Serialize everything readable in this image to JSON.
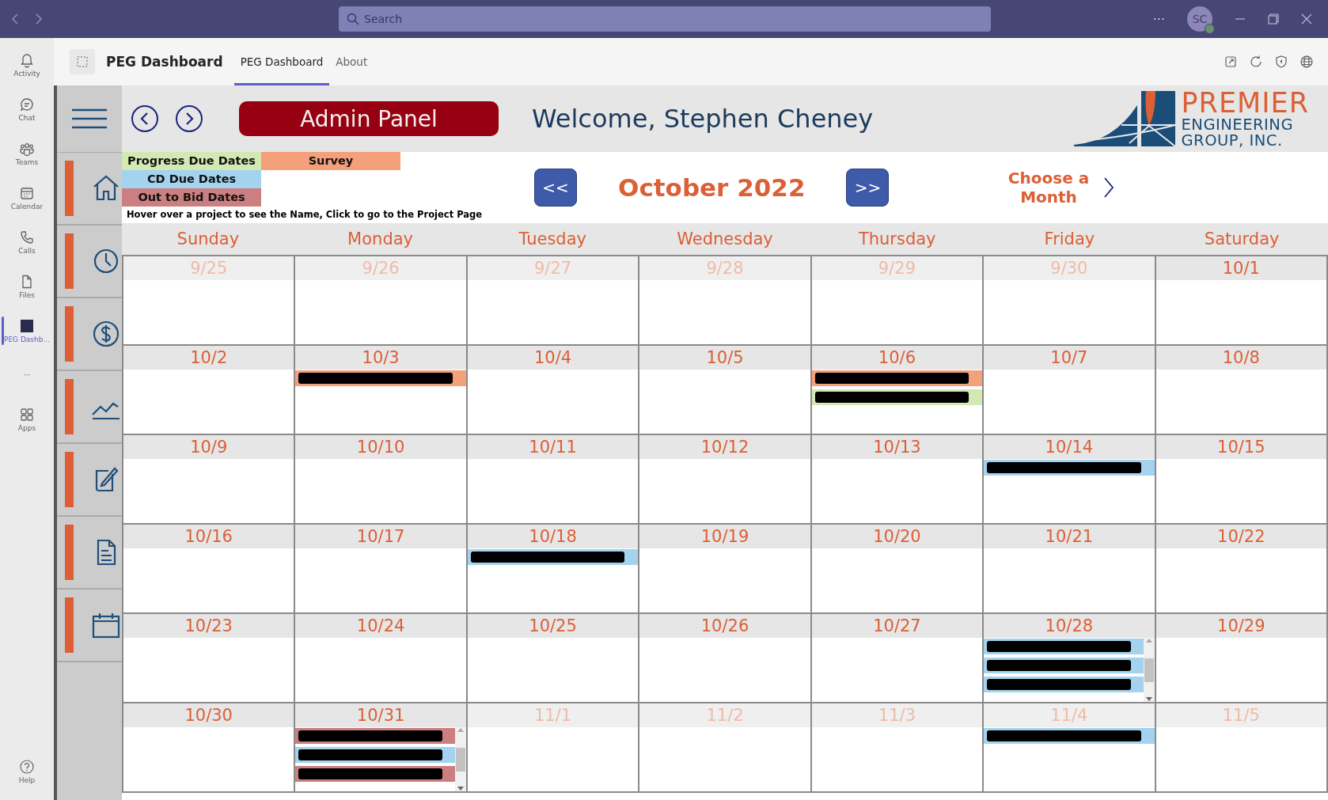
{
  "title_bar": {
    "search": {
      "placeholder": "Search"
    },
    "more": "···",
    "avatar": "SC"
  },
  "teams_rail": [
    {
      "label": "Activity",
      "selected": false
    },
    {
      "label": "Chat",
      "selected": false
    },
    {
      "label": "Teams",
      "selected": false
    },
    {
      "label": "Calendar",
      "selected": false
    },
    {
      "label": "Calls",
      "selected": false
    },
    {
      "label": "Files",
      "selected": false
    },
    {
      "label": "PEG Dashb...",
      "selected": true
    },
    {
      "label": "···",
      "selected": false
    },
    {
      "label": "Apps",
      "selected": false
    }
  ],
  "help": {
    "label": "Help"
  },
  "app_header": {
    "title": "PEG Dashboard",
    "tabs": [
      {
        "label": "PEG Dashboard",
        "selected": true
      },
      {
        "label": "About",
        "selected": false
      }
    ]
  },
  "header": {
    "admin_button": "Admin Panel",
    "welcome": "Welcome, Stephen Cheney",
    "logo": [
      "PREMIER",
      "ENGINEERING",
      "GROUP, INC."
    ]
  },
  "legend": [
    {
      "label": "Progress Due Dates",
      "color": "#d4e8b3"
    },
    {
      "label": "Survey",
      "color": "#f4a07a"
    },
    {
      "label": "CD Due Dates",
      "color": "#a3d3ee"
    },
    {
      "label": "Out to Bid Dates",
      "color": "#cc7f80"
    }
  ],
  "hint": "Hover over a project to see the Name, Click to go to the Project Page",
  "month_nav": {
    "prev": "<<",
    "month": "October 2022",
    "next": ">>",
    "choose": "Choose a Month"
  },
  "weekdays": [
    "Sunday",
    "Monday",
    "Tuesday",
    "Wednesday",
    "Thursday",
    "Friday",
    "Saturday"
  ],
  "days": [
    {
      "date": "9/25",
      "in_month": false
    },
    {
      "date": "9/26",
      "in_month": false
    },
    {
      "date": "9/27",
      "in_month": false
    },
    {
      "date": "9/28",
      "in_month": false
    },
    {
      "date": "9/29",
      "in_month": false
    },
    {
      "date": "9/30",
      "in_month": false
    },
    {
      "date": "10/1",
      "in_month": true
    },
    {
      "date": "10/2",
      "in_month": true
    },
    {
      "date": "10/3",
      "in_month": true,
      "events": [
        {
          "color": "#f4a07a"
        }
      ]
    },
    {
      "date": "10/4",
      "in_month": true
    },
    {
      "date": "10/5",
      "in_month": true
    },
    {
      "date": "10/6",
      "in_month": true,
      "events": [
        {
          "color": "#f4a07a"
        },
        {
          "color": "#d4e8b3"
        }
      ]
    },
    {
      "date": "10/7",
      "in_month": true
    },
    {
      "date": "10/8",
      "in_month": true
    },
    {
      "date": "10/9",
      "in_month": true
    },
    {
      "date": "10/10",
      "in_month": true
    },
    {
      "date": "10/11",
      "in_month": true
    },
    {
      "date": "10/12",
      "in_month": true
    },
    {
      "date": "10/13",
      "in_month": true
    },
    {
      "date": "10/14",
      "in_month": true,
      "events": [
        {
          "color": "#a3d3ee"
        }
      ]
    },
    {
      "date": "10/15",
      "in_month": true
    },
    {
      "date": "10/16",
      "in_month": true
    },
    {
      "date": "10/17",
      "in_month": true
    },
    {
      "date": "10/18",
      "in_month": true,
      "events": [
        {
          "color": "#a3d3ee"
        }
      ]
    },
    {
      "date": "10/19",
      "in_month": true
    },
    {
      "date": "10/20",
      "in_month": true
    },
    {
      "date": "10/21",
      "in_month": true
    },
    {
      "date": "10/22",
      "in_month": true
    },
    {
      "date": "10/23",
      "in_month": true
    },
    {
      "date": "10/24",
      "in_month": true
    },
    {
      "date": "10/25",
      "in_month": true
    },
    {
      "date": "10/26",
      "in_month": true
    },
    {
      "date": "10/27",
      "in_month": true
    },
    {
      "date": "10/28",
      "in_month": true,
      "events": [
        {
          "color": "#a3d3ee"
        },
        {
          "color": "#a3d3ee"
        },
        {
          "color": "#a3d3ee"
        }
      ]
    },
    {
      "date": "10/29",
      "in_month": true
    },
    {
      "date": "10/30",
      "in_month": true
    },
    {
      "date": "10/31",
      "in_month": true,
      "events": [
        {
          "color": "#cc7f80"
        },
        {
          "color": "#a3d3ee"
        },
        {
          "color": "#cc7f80"
        }
      ]
    },
    {
      "date": "11/1",
      "in_month": false
    },
    {
      "date": "11/2",
      "in_month": false
    },
    {
      "date": "11/3",
      "in_month": false
    },
    {
      "date": "11/4",
      "in_month": false,
      "events": [
        {
          "color": "#a3d3ee"
        }
      ]
    },
    {
      "date": "11/5",
      "in_month": false
    }
  ]
}
